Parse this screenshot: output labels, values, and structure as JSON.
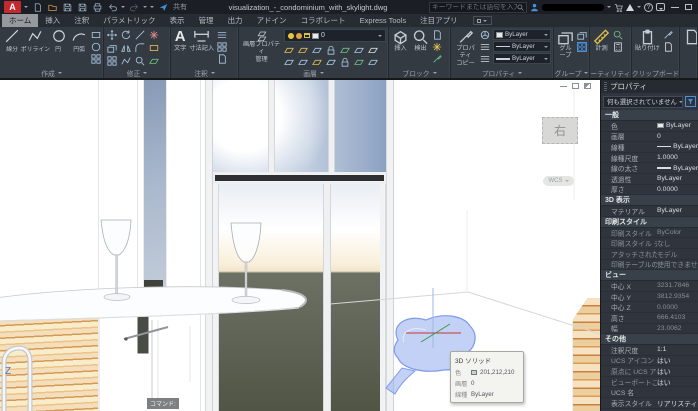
{
  "colors": {
    "selection_chair": "#84a2ee",
    "tooltip_swatch": "#c9d4d2",
    "active_tab_bg": "#96999d",
    "accent_blue": "#4a90d9",
    "logo_red": "#c22a30"
  },
  "icons": {
    "help": "?"
  },
  "titlebar": {
    "logo": "A",
    "share": "共有",
    "filename": "visualization_-_condominium_with_skylight.dwg",
    "search_placeholder": "キーワードまたは語句を入力"
  },
  "tabs": [
    {
      "label": "ホーム"
    },
    {
      "label": "挿入"
    },
    {
      "label": "注釈"
    },
    {
      "label": "パラメトリック"
    },
    {
      "label": "表示"
    },
    {
      "label": "管理"
    },
    {
      "label": "出力"
    },
    {
      "label": "アドイン"
    },
    {
      "label": "コラボレート"
    },
    {
      "label": "Express Tools"
    },
    {
      "label": "注目アプリ"
    }
  ],
  "ribbon": {
    "draw": {
      "label": "作成",
      "line": "線分",
      "polyline": "ポリライン",
      "circle": "円",
      "arc": "円弧"
    },
    "modify": {
      "label": "修正"
    },
    "annotate": {
      "label": "注釈",
      "text": "文字",
      "dimension": "寸法記入"
    },
    "layers": {
      "label": "画層",
      "manager1": "画層プロパティ",
      "manager2": "管理",
      "current_layer": "0"
    },
    "block": {
      "label": "ブロック",
      "insert": "挿入",
      "detect": "検出"
    },
    "props": {
      "label": "プロパティ",
      "match1": "プロパティ",
      "match2": "コピー",
      "bylayer": "ByLayer"
    },
    "group": {
      "label": "グループ",
      "group": "グループ"
    },
    "util": {
      "label": "ユーティリティ",
      "measure": "計測"
    },
    "clip": {
      "label": "クリップボード",
      "paste": "貼り付け"
    }
  },
  "canvas": {
    "viewcube_face": "右",
    "ucs_label": "WCS",
    "command_label": "コマンド:",
    "axis_z": "Z"
  },
  "tooltip": {
    "title": "3D ソリッド",
    "color_label": "色",
    "color_value": "201,212,210",
    "layer_label": "画層",
    "layer_value": "0",
    "linetype_label": "線種",
    "linetype_value": "ByLayer"
  },
  "palette": {
    "title": "プロパティ",
    "selector": "何も選択されていません",
    "sec_general": "一般",
    "rows_general": [
      {
        "label": "色",
        "value": "ByLayer"
      },
      {
        "label": "画層",
        "value": "0"
      },
      {
        "label": "線種",
        "value": "ByLayer"
      },
      {
        "label": "線種尺度",
        "value": "1.0000"
      },
      {
        "label": "線の太さ",
        "value": "ByLayer"
      },
      {
        "label": "透過性",
        "value": "ByLayer"
      },
      {
        "label": "厚さ",
        "value": "0.0000"
      }
    ],
    "sec_3d": "3D 表示",
    "rows_3d": [
      {
        "label": "マテリアル",
        "value": "ByLayer"
      }
    ],
    "sec_plot": "印刷スタイル",
    "rows_plot": [
      {
        "label": "印刷スタイル",
        "value": "ByColor"
      },
      {
        "label": "印刷スタイル テ...",
        "value": "なし"
      },
      {
        "label": "アタッチされた...",
        "value": "モデル"
      },
      {
        "label": "印刷テーブルの...",
        "value": "使用できません"
      }
    ],
    "sec_view": "ビュー",
    "rows_view": [
      {
        "label": "中心 X",
        "value": "3231.7846"
      },
      {
        "label": "中心 Y",
        "value": "3812.9354"
      },
      {
        "label": "中心 Z",
        "value": "0.0000"
      },
      {
        "label": "高さ",
        "value": "666.4103"
      },
      {
        "label": "幅",
        "value": "23.0062"
      }
    ],
    "sec_misc": "その他",
    "rows_misc": [
      {
        "label": "注釈尺度",
        "value": "1:1"
      },
      {
        "label": "UCS アイコン オ...",
        "value": "はい"
      },
      {
        "label": "原点に UCS ア...",
        "value": "はい"
      },
      {
        "label": "ビューポートごと...",
        "value": "はい"
      },
      {
        "label": "UCS 名",
        "value": ""
      },
      {
        "label": "表示スタイル",
        "value": "リアリスティック"
      }
    ]
  }
}
